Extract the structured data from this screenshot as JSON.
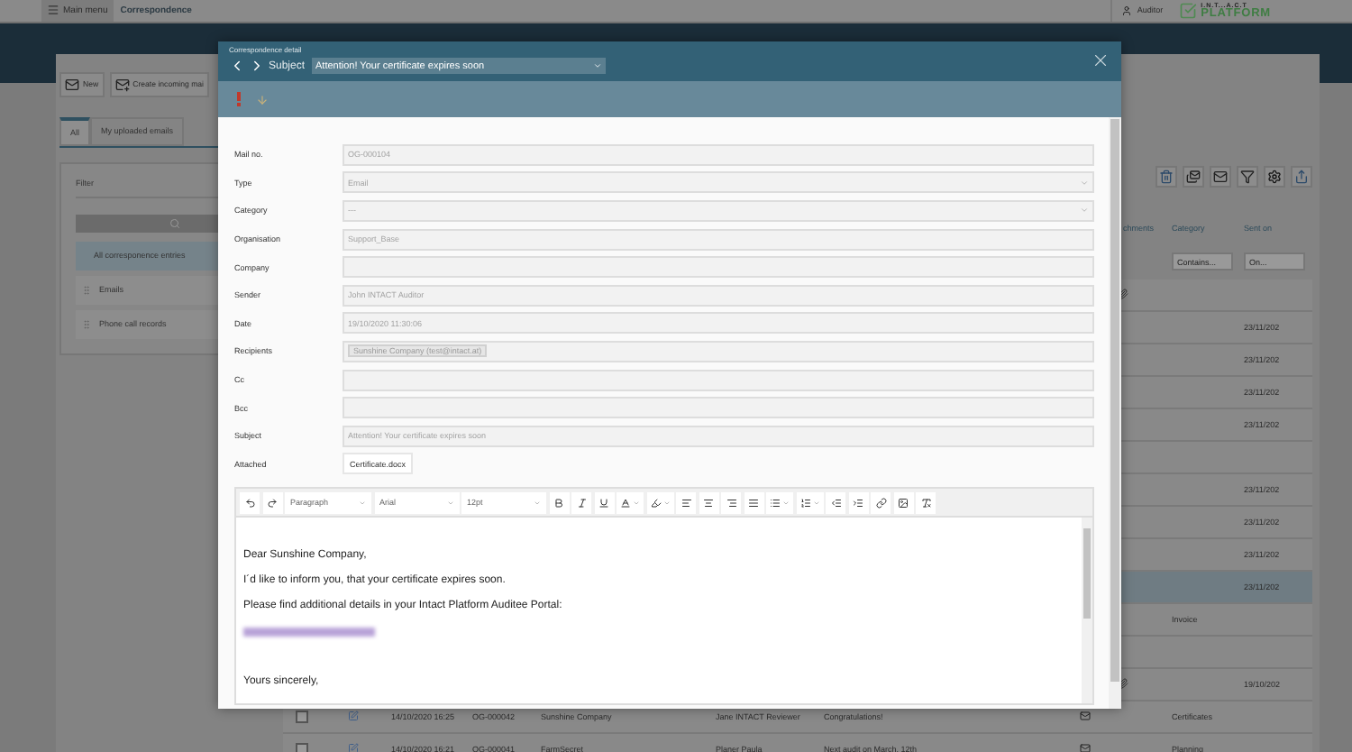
{
  "app_bar": {
    "menu_label": "Main menu",
    "section": "Correspondence",
    "user": "Auditor",
    "logo_top": "I.N.T...A.C.T",
    "logo_bottom": "PLATFORM"
  },
  "actions": [
    "New",
    "Create incoming mai"
  ],
  "tabs": [
    {
      "label": "All",
      "selected": true
    },
    {
      "label": "My uploaded emails",
      "selected": false
    }
  ],
  "filter": {
    "title": "Filter",
    "items": [
      {
        "label": "All corresponence entries",
        "selected": true
      },
      {
        "label": "Emails",
        "selected": false
      },
      {
        "label": "Phone call records",
        "selected": false
      }
    ]
  },
  "table": {
    "columns": [
      "chments",
      "Category",
      "Sent on"
    ],
    "filters": [
      {
        "placeholder": "Contains..."
      },
      {
        "placeholder": "On..."
      }
    ],
    "rows": [
      {
        "kind": "partial",
        "selected": false,
        "attachment": true
      },
      {
        "kind": "partial",
        "selected": false,
        "attachment": false,
        "sent_on": "23/11/202"
      },
      {
        "kind": "partial",
        "selected": false,
        "attachment": false,
        "sent_on": "23/11/202"
      },
      {
        "kind": "partial",
        "selected": false,
        "attachment": false,
        "sent_on": "23/11/202"
      },
      {
        "kind": "partial",
        "selected": false,
        "attachment": false,
        "sent_on": "23/11/202"
      },
      {
        "kind": "partial",
        "selected": false,
        "attachment": false
      },
      {
        "kind": "partial",
        "selected": false,
        "attachment": false,
        "sent_on": "23/11/202"
      },
      {
        "kind": "partial",
        "selected": false,
        "attachment": false,
        "sent_on": "23/11/202"
      },
      {
        "kind": "partial",
        "selected": false,
        "attachment": false,
        "sent_on": "23/11/202"
      },
      {
        "kind": "partial",
        "selected": true,
        "attachment": false,
        "sent_on": "23/11/202"
      },
      {
        "kind": "partial",
        "selected": false,
        "attachment": false,
        "category": "Invoice"
      },
      {
        "kind": "partial",
        "selected": false,
        "attachment": false
      },
      {
        "kind": "partial",
        "selected": false,
        "attachment": true,
        "sent_on": "19/10/202"
      },
      {
        "kind": "full",
        "selected": false,
        "attachment": false,
        "date": "14/10/2020 16:25",
        "mail_no": "OG-000042",
        "company": "Sunshine Company",
        "sender": "Jane INTACT Reviewer",
        "subject": "Congratulations!",
        "category": "Certificates"
      },
      {
        "kind": "full",
        "selected": false,
        "attachment": false,
        "date": "14/10/2020 16:21",
        "mail_no": "OG-000041",
        "company": "FarmSecret",
        "sender": "Planer Paula",
        "subject": "Next audit on March, 12th",
        "category": "Planning"
      }
    ]
  },
  "dialog": {
    "caption": "Correspondence detail",
    "subject_label": "Subject",
    "subject": "Attention! Your certificate expires soon",
    "fields": [
      {
        "label": "Mail no.",
        "kind": "text",
        "value": "OG-000104"
      },
      {
        "label": "Type",
        "kind": "select",
        "value": "Email"
      },
      {
        "label": "Category",
        "kind": "select",
        "value": "---"
      },
      {
        "label": "Organisation",
        "kind": "text",
        "value": "Support_Base"
      },
      {
        "label": "Company",
        "kind": "text"
      },
      {
        "label": "Sender",
        "kind": "text",
        "value": "John INTACT Auditor"
      },
      {
        "label": "Date",
        "kind": "text",
        "value": "19/10/2020 11:30:06"
      },
      {
        "label": "Recipients",
        "kind": "tags",
        "tags": [
          "Sunshine Company (test@intact.at)"
        ]
      },
      {
        "label": "Cc",
        "kind": "text"
      },
      {
        "label": "Bcc",
        "kind": "text"
      },
      {
        "label": "Subject",
        "kind": "text",
        "value": "Attention! Your certificate expires soon"
      },
      {
        "label": "Attached",
        "kind": "files",
        "files": [
          "Certificate.docx"
        ]
      }
    ],
    "editor": {
      "block_format": "Paragraph",
      "font": "Arial",
      "size": "12pt",
      "paragraphs": [
        {
          "kind": "text",
          "text": "Dear  Sunshine Company,"
        },
        {
          "kind": "text",
          "text": "I´d like to inform you, that your certificate expires soon."
        },
        {
          "kind": "text",
          "text": "Please find additional details in your Intact Platform Auditee Portal:"
        },
        {
          "kind": "blurred-link"
        },
        {
          "kind": "blank"
        },
        {
          "kind": "text",
          "text": "Yours sincerely,"
        }
      ]
    }
  }
}
